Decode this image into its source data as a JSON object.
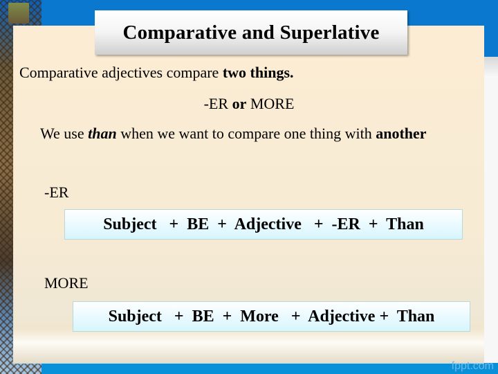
{
  "slide": {
    "title": "Comparative and Superlative",
    "intro": {
      "prefix": "Comparative adjectives compare ",
      "emphasis": "two things."
    },
    "subheading": {
      "part1": "-ER ",
      "part2": "or",
      "part3": " MORE"
    },
    "usage": {
      "prefix": "We use ",
      "keyword": "than",
      "middle": " when we want to compare one thing with ",
      "emphasis": "another"
    },
    "sections": [
      {
        "label": "-ER",
        "formula": "Subject   +  BE  +  Adjective   +  -ER  +  Than"
      },
      {
        "label": "MORE",
        "formula": "Subject   +  BE  +  More   +  Adjective +  Than"
      }
    ],
    "watermark": "fppt.com"
  },
  "theme": {
    "background_blue": "#0a78cf",
    "panel_cream": "#fcecd3",
    "formula_box_cyan": "#d6f5fc"
  }
}
